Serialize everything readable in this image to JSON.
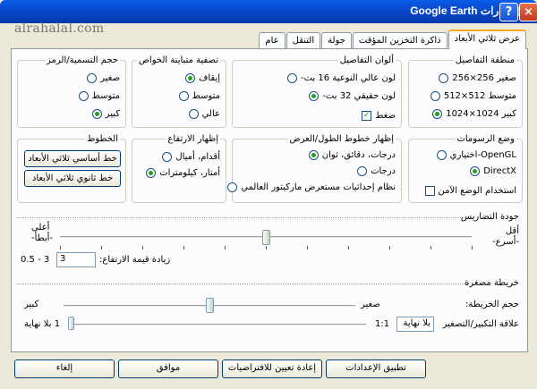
{
  "window": {
    "title": "خيارات Google Earth",
    "watermark": "alrahalal.com"
  },
  "tabs": [
    "عرض ثلاثي الأبعاد",
    "ذاكرة التخزين المؤقت",
    "جولة",
    "التنقل",
    "عام"
  ],
  "texture": {
    "title": "منطقة التفاصيل",
    "options": [
      "صغير 256×256",
      "متوسط 512×512",
      "كبير 1024×1024"
    ],
    "selected": 2
  },
  "colors": {
    "title": "ألوان التفاصيل",
    "options": [
      "لون عالي النوعية 16 بت-",
      "لون حقيقي 32 بت-"
    ],
    "selected": 1,
    "compress": "ضغط",
    "compress_checked": true
  },
  "anisotropic": {
    "title": "تصفية متباينة الخواص",
    "options": [
      "إيقاف",
      "متوسط",
      "عالي"
    ],
    "selected": 0
  },
  "labels": {
    "title": "حجم التسمية/الرمز",
    "options": [
      "صغير",
      "متوسط",
      "كبير"
    ],
    "selected": 2
  },
  "graphics": {
    "title": "وضع الرسومات",
    "options": [
      "OpenGL-اختياري",
      "DirectX"
    ],
    "selected": 1,
    "safe_mode": "استخدام الوضع الآمن",
    "safe_checked": false
  },
  "latlon": {
    "title": "إظهار خطوط الطول/العرض",
    "options": [
      "درجات، دقائق، ثوان",
      "درجات",
      "نظام إحداثيات مستعرض ماركيتور العالمي"
    ],
    "selected": 0
  },
  "elevation": {
    "title": "إظهار الارتفاع",
    "options": [
      "أقدام، أميال",
      "أمتار، كيلومترات"
    ],
    "selected": 1
  },
  "fonts": {
    "title": "الخطوط",
    "btn1": "خط أساسي ثلاثي الأبعاد",
    "btn2": "خط ثانوي ثلاثي الأبعاد"
  },
  "terrain": {
    "title": "جودة التضاريس",
    "less": "أقل",
    "faster": "-أسرع-",
    "more": "أعلى",
    "prettier": "-أبطأ-",
    "exag_label": "زيادة قيمة الارتفاع:",
    "exag_value": "3",
    "exag_range": "0.5 - 3",
    "quality_fraction": 0.5
  },
  "overview": {
    "title": "خريطة مصغرة",
    "size_label": "حجم الخريطة:",
    "small": "صغير",
    "large": "كبير",
    "size_fraction": 0.5,
    "zoom_label": "علاقة التكبير/التصغير",
    "zoom_value": "بلا نهاية",
    "one": "1:1",
    "inf": "1 بلا نهاية",
    "zoom_fraction": 0.0
  },
  "buttons": {
    "apply": "تطبيق الإعدادات",
    "defaults": "إعادة تعيين للافتراضيات",
    "ok": "موافق",
    "cancel": "إلغاء"
  }
}
